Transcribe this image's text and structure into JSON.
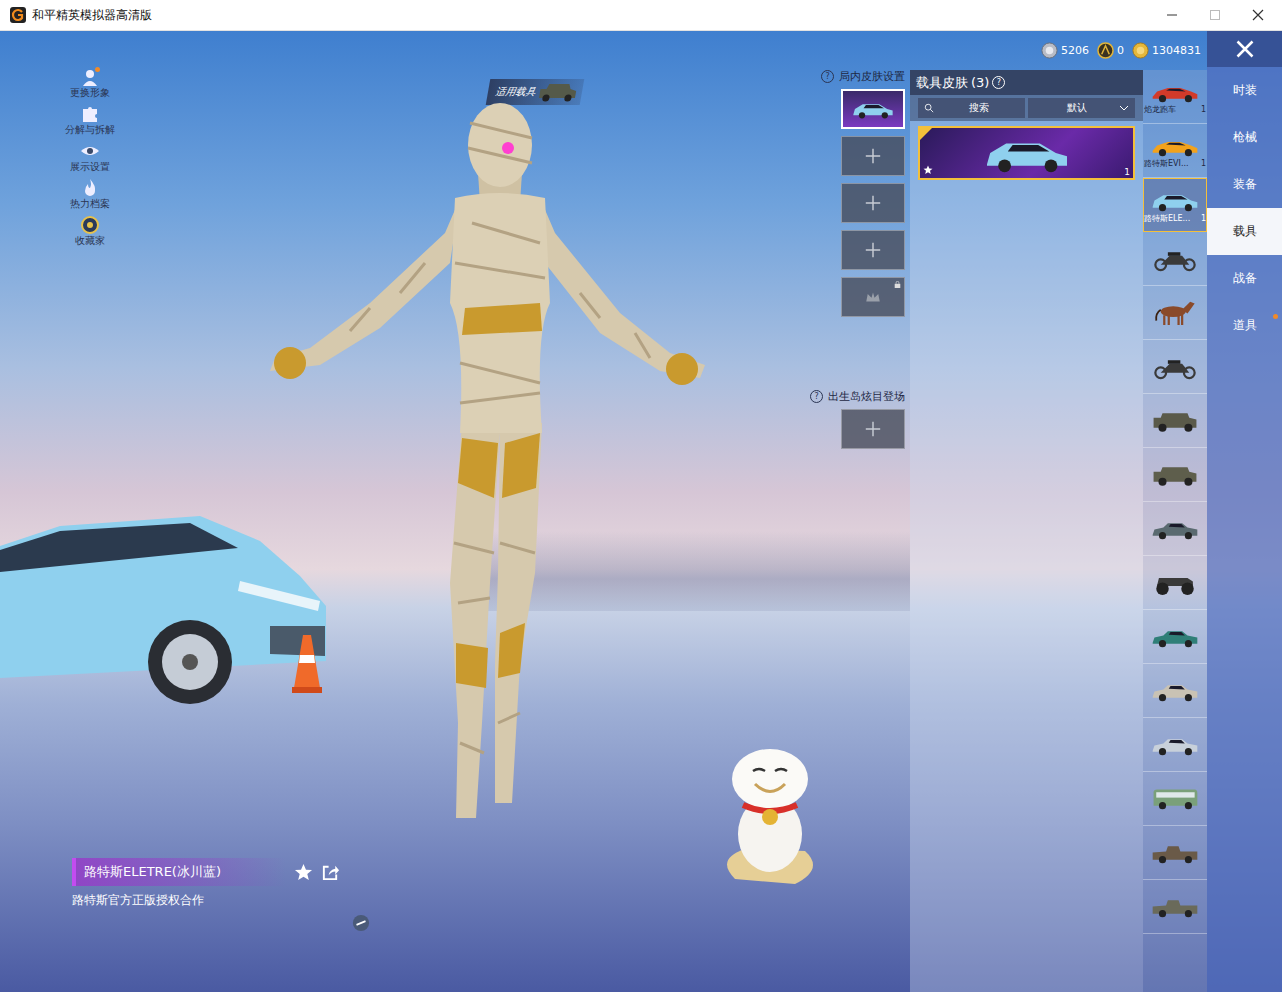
{
  "window": {
    "title": "和平精英模拟器高清版"
  },
  "currency": [
    {
      "kind": "silver",
      "value": "5206"
    },
    {
      "kind": "gold_a",
      "value": "0"
    },
    {
      "kind": "gold",
      "value": "1304831"
    }
  ],
  "left_menu": [
    {
      "label": "更换形象",
      "kind": "avatar",
      "dot": true
    },
    {
      "label": "分解与拆解",
      "kind": "puzzle",
      "dot": false
    },
    {
      "label": "展示设置",
      "kind": "eye",
      "dot": false
    },
    {
      "label": "热力档案",
      "kind": "fire",
      "dot": false
    },
    {
      "label": "收藏家",
      "kind": "badge",
      "dot": false
    }
  ],
  "vehicle_tag": {
    "label": "适用载具"
  },
  "skin_slots": {
    "label": "局内皮肤设置",
    "help": "?",
    "slots": [
      {
        "kind": "filled",
        "selected": true
      },
      {
        "kind": "empty",
        "selected": false
      },
      {
        "kind": "empty",
        "selected": false
      },
      {
        "kind": "empty",
        "selected": false
      },
      {
        "kind": "locked",
        "selected": false
      }
    ]
  },
  "entrance": {
    "label": "出生岛炫目登场",
    "help": "?",
    "slots": [
      {
        "kind": "empty",
        "selected": false
      }
    ]
  },
  "skin_panel": {
    "title": "载具皮肤",
    "count": "(3)",
    "help": "?",
    "search_placeholder": "搜索",
    "sort": "默认",
    "skins": [
      {
        "selected": true,
        "starred": true,
        "count": "1",
        "color": "#8fd0ee"
      }
    ]
  },
  "vehicles": [
    {
      "kind": "sports_car",
      "label": "焰龙跑车",
      "count": "1",
      "selected": false,
      "color": "#d23a2a"
    },
    {
      "kind": "sports_car",
      "label": "路特斯EVI...",
      "count": "1",
      "selected": false,
      "color": "#f2a21c"
    },
    {
      "kind": "suv",
      "label": "路特斯ELE...",
      "count": "1",
      "selected": true,
      "color": "#8fd0ee"
    },
    {
      "kind": "motorcycle",
      "label": "",
      "count": "",
      "selected": false,
      "color": "#3a3a3a"
    },
    {
      "kind": "horse",
      "label": "",
      "count": "",
      "selected": false,
      "color": "#8a4a2a"
    },
    {
      "kind": "motorcycle",
      "label": "",
      "count": "",
      "selected": false,
      "color": "#3a3a3a"
    },
    {
      "kind": "jeep",
      "label": "",
      "count": "",
      "selected": false,
      "color": "#5a5a4a"
    },
    {
      "kind": "jeep",
      "label": "",
      "count": "",
      "selected": false,
      "color": "#5e5e4c"
    },
    {
      "kind": "sedan",
      "label": "",
      "count": "",
      "selected": false,
      "color": "#5a6a70"
    },
    {
      "kind": "monster_truck",
      "label": "",
      "count": "",
      "selected": false,
      "color": "#3a3a3a"
    },
    {
      "kind": "sedan",
      "label": "",
      "count": "",
      "selected": false,
      "color": "#2f7f78"
    },
    {
      "kind": "sedan",
      "label": "",
      "count": "",
      "selected": false,
      "color": "#c9c2b4"
    },
    {
      "kind": "sedan",
      "label": "",
      "count": "",
      "selected": false,
      "color": "#c8d0da"
    },
    {
      "kind": "bus",
      "label": "",
      "count": "",
      "selected": false,
      "color": "#7aa07a"
    },
    {
      "kind": "pickup",
      "label": "",
      "count": "",
      "selected": false,
      "color": "#6a5a48"
    },
    {
      "kind": "pickup",
      "label": "",
      "count": "",
      "selected": false,
      "color": "#6a6a5a"
    }
  ],
  "tabs": [
    {
      "label": "时装",
      "selected": false,
      "dot": false
    },
    {
      "label": "枪械",
      "selected": false,
      "dot": false
    },
    {
      "label": "装备",
      "selected": false,
      "dot": false
    },
    {
      "label": "载具",
      "selected": true,
      "dot": false
    },
    {
      "label": "战备",
      "selected": false,
      "dot": false
    },
    {
      "label": "道具",
      "selected": false,
      "dot": true
    }
  ],
  "item": {
    "name": "路特斯ELETRE(冰川蓝)",
    "description": "路特斯官方正版授权合作"
  }
}
